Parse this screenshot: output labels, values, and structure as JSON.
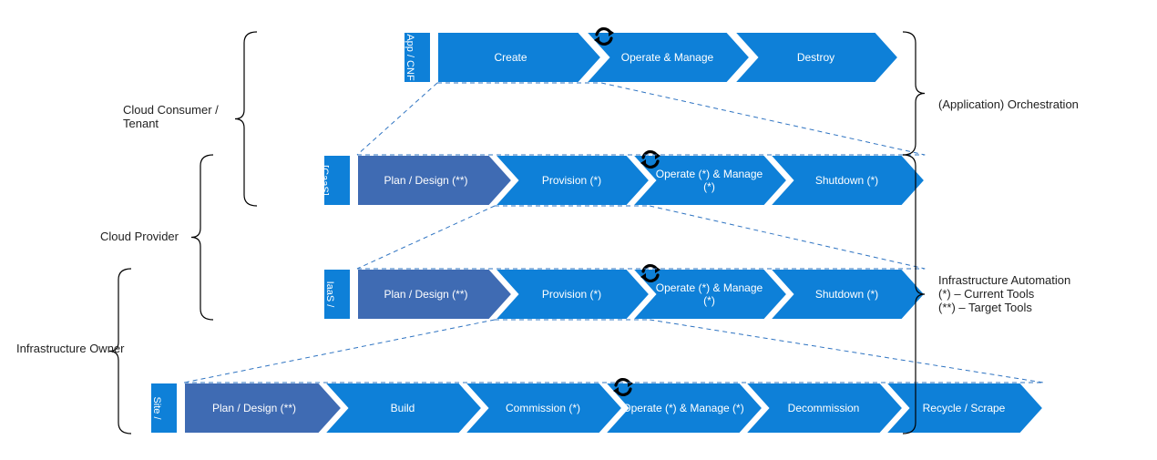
{
  "left_roles": {
    "consumer": "Cloud Consumer / Tenant",
    "provider": "Cloud Provider",
    "owner": "Infrastructure Owner"
  },
  "right_labels": {
    "orchestration": "(Application) Orchestration",
    "infra_auto_1": "Infrastructure Automation",
    "infra_auto_2": "(*) – Current Tools",
    "infra_auto_3": "(**) – Target Tools"
  },
  "rows": {
    "app": {
      "tab": "App / CNF / VNF",
      "stages": [
        "Create",
        "Operate & Manage",
        "Destroy"
      ]
    },
    "caas": {
      "tab": "[CaaS]",
      "stages": [
        "Plan / Design (**)",
        "Provision (*)",
        "Operate (*) & Manage (*)",
        "Shutdown (*)"
      ]
    },
    "iaas": {
      "tab": "IaaS / CaaS",
      "stages": [
        "Plan / Design (**)",
        "Provision (*)",
        "Operate (*) & Manage (*)",
        "Shutdown (*)"
      ]
    },
    "phys": {
      "tab": "Site / Physical",
      "stages": [
        "Plan / Design (**)",
        "Build",
        "Commission (*)",
        "Operate (*) & Manage (*)",
        "Decommission",
        "Recycle / Scrape"
      ]
    }
  },
  "colors": {
    "blue": "#0e80d8",
    "blue_dark": "#3f6bb3",
    "dash": "#2f74c2"
  }
}
